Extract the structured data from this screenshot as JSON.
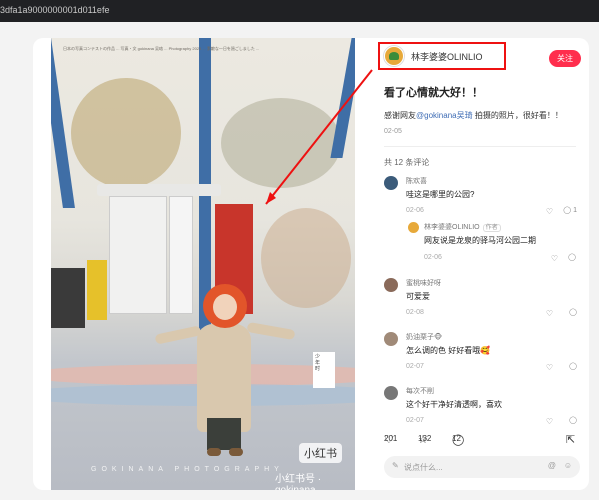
{
  "url": "3dfa1a9000000001d011efe",
  "photo": {
    "text": "日本の写真コンテストの作品 ... 写真・文 gokinana 吴珞 ... Photography 2023 ... 素敵な一日を過ごしました ...",
    "brand_watermark": "小红书",
    "watermark": "小红书号 · gokinana",
    "deco": "GOKINANA PHOTOGRAPHY"
  },
  "post": {
    "author": "林李婆婆OLINLIO",
    "follow_label": "关注",
    "title": "看了心情就大好！！",
    "desc_prefix": "感谢网友",
    "desc_mention": "@gokinana吴琦",
    "desc_suffix": " 拍摄的照片，很好看！！",
    "date": "02-05",
    "comment_count_label": "共 12 条评论"
  },
  "comments": [
    {
      "name": "陈欢喜",
      "text": "哇这是哪里的公园?",
      "date": "02-06",
      "replies": "1",
      "avatar_color": "#3b5b7a"
    },
    {
      "name": "林李婆婆OLINLIO",
      "tag": "作者",
      "text": "网友说是龙泉的驿马河公园二期",
      "date": "02-06",
      "avatar_color": "#e7a93a"
    },
    {
      "name": "蜜桃味好呀",
      "text": "可爱爱",
      "date": "02-08",
      "avatar_color": "#8a6a5a"
    },
    {
      "name": "奶油栗子🐵",
      "text": "怎么调的色 好好看哦🥰",
      "date": "02-07",
      "avatar_color": "#a08a78"
    },
    {
      "name": "每次不削",
      "text": "这个好干净好清透啊，喜欢",
      "date": "02-07",
      "avatar_color": "#777777"
    }
  ],
  "actions": {
    "likes": "201",
    "stars": "132",
    "comments": "12"
  },
  "input_placeholder": "说点什么...",
  "icons": {
    "heart": "heart-icon",
    "star": "star-icon",
    "comment": "comment-icon",
    "share": "share-icon",
    "pen": "pen-icon",
    "at": "at-icon",
    "emoji": "emoji-icon"
  }
}
